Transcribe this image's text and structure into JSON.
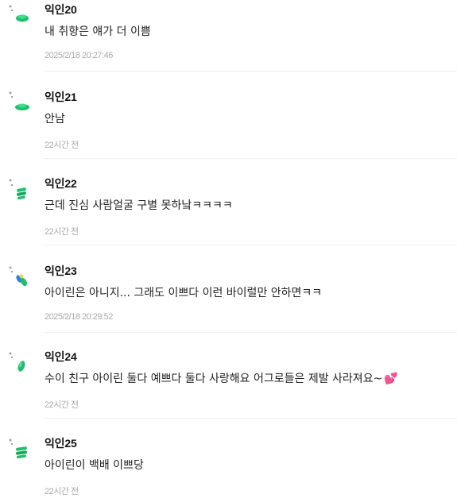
{
  "comments": [
    {
      "name": "익인20",
      "text": "내 취향은 얘가 더 이쁨",
      "time": "2025/2/18 20:27:46",
      "emoji": ""
    },
    {
      "name": "익인21",
      "text": "안남",
      "time": "22시간 전",
      "emoji": ""
    },
    {
      "name": "익인22",
      "text": "근데 진심 사람얼굴 구별 못하낰ㅋㅋㅋㅋ",
      "time": "22시간 전",
      "emoji": ""
    },
    {
      "name": "익인23",
      "text": "아이린은 아니지... 그래도 이쁘다 이런 바이럴만 안하면ㅋㅋ",
      "time": "2025/2/18 20:29:52",
      "emoji": ""
    },
    {
      "name": "익인24",
      "text": "수이 친구 아이린 둘다 예쁘다 둘다 사랑해요 어그로들은 제발 사라져요~",
      "time": "22시간 전",
      "emoji": "💕"
    },
    {
      "name": "익인25",
      "text": "아이린이 백배 이쁘당",
      "time": "22시간 전",
      "emoji": ""
    }
  ],
  "colors": {
    "avatar_green": "#1fbf6e",
    "avatar_blue": "#2f7de0",
    "avatar_yellow": "#f3d43a",
    "emoji_pink": "#ff4f9a"
  }
}
